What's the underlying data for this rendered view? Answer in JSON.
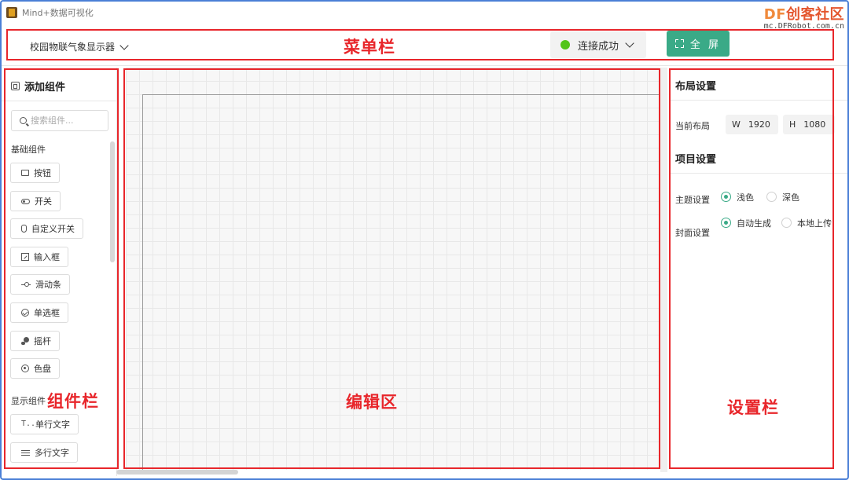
{
  "app": {
    "title": "Mind+数据可视化"
  },
  "watermark": {
    "logo_df": "DF",
    "logo_text": "创客社区",
    "url": "mc.DFRobot.com.cn"
  },
  "menubar": {
    "project_name": "校园物联气象显示器",
    "connection_status": "连接成功",
    "connection_color": "#52c41a",
    "fullscreen_label": "全 屏",
    "accent_color": "#3aaa87"
  },
  "components": {
    "header": "添加组件",
    "search_placeholder": "搜索组件...",
    "basic_group": "基础组件",
    "basic_items": [
      {
        "label": "按钮",
        "icon": "button-icon"
      },
      {
        "label": "开关",
        "icon": "switch-icon"
      },
      {
        "label": "自定义开关",
        "icon": "custom-switch-icon"
      },
      {
        "label": "输入框",
        "icon": "input-icon"
      },
      {
        "label": "滑动条",
        "icon": "slider-icon"
      },
      {
        "label": "单选框",
        "icon": "radio-icon"
      },
      {
        "label": "摇杆",
        "icon": "joystick-icon"
      },
      {
        "label": "色盘",
        "icon": "palette-icon"
      }
    ],
    "display_group": "显示组件",
    "display_items": [
      {
        "label": "单行文字",
        "icon": "text-icon"
      },
      {
        "label": "多行文字",
        "icon": "multiline-text-icon"
      }
    ]
  },
  "settings": {
    "layout_title": "布局设置",
    "current_layout_label": "当前布局",
    "width_key": "W",
    "width_value": "1920",
    "height_key": "H",
    "height_value": "1080",
    "project_title": "项目设置",
    "theme_label": "主题设置",
    "theme_options": [
      "浅色",
      "深色"
    ],
    "theme_selected": "浅色",
    "cover_label": "封面设置",
    "cover_options": [
      "自动生成",
      "本地上传"
    ],
    "cover_selected": "自动生成"
  },
  "annotations": {
    "menubar": "菜单栏",
    "components": "组件栏",
    "editor": "编辑区",
    "settings": "设置栏",
    "color": "#e8262b"
  }
}
